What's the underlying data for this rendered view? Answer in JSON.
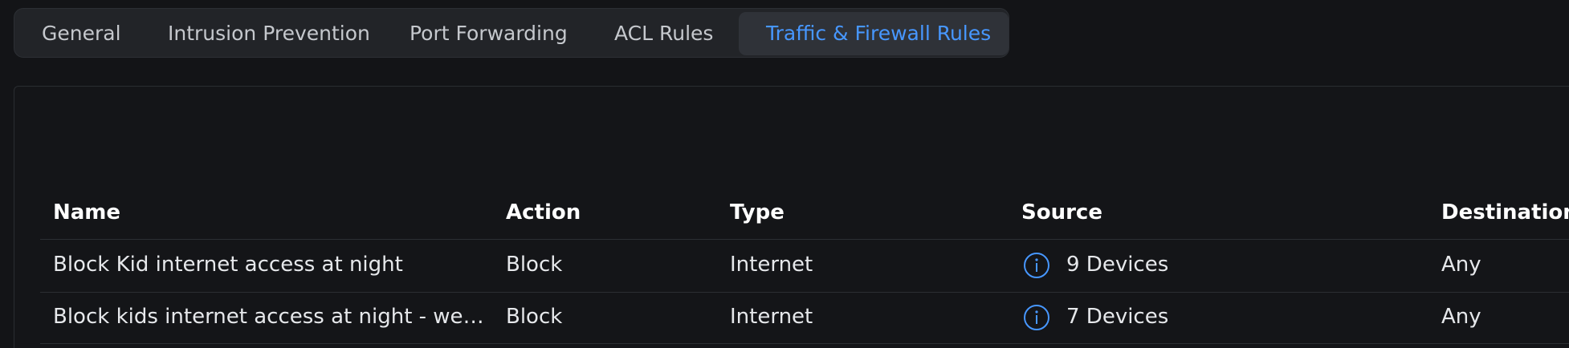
{
  "tabs": [
    {
      "label": "General",
      "active": false
    },
    {
      "label": "Intrusion Prevention",
      "active": false
    },
    {
      "label": "Port Forwarding",
      "active": false
    },
    {
      "label": "ACL Rules",
      "active": false
    },
    {
      "label": "Traffic & Firewall Rules",
      "active": true
    }
  ],
  "table": {
    "columns": [
      "Name",
      "Action",
      "Type",
      "Source",
      "Destination"
    ],
    "rows": [
      {
        "name": "Block Kid internet access at night",
        "action": "Block",
        "type": "Internet",
        "source": "9 Devices",
        "source_icon": "info-icon",
        "destination": "Any"
      },
      {
        "name": "Block kids internet access at night - weeken...",
        "action": "Block",
        "type": "Internet",
        "source": "7 Devices",
        "source_icon": "info-icon",
        "destination": "Any"
      }
    ]
  },
  "colors": {
    "accent": "#4797ff",
    "background": "#131417",
    "tabbar": "#222428",
    "active_tab": "#2f3238"
  }
}
